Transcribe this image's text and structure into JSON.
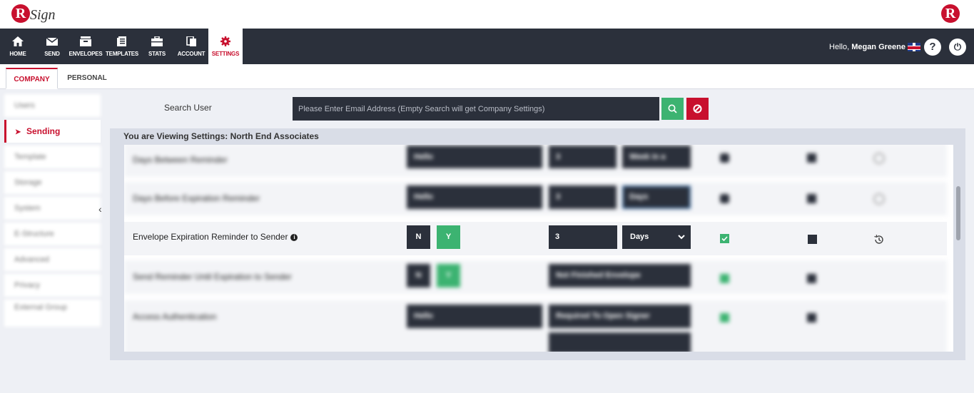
{
  "brand": {
    "logo_letter": "R",
    "logo_word": "Sign",
    "right_logo_letter": "R"
  },
  "nav": {
    "items": [
      {
        "label": "HOME"
      },
      {
        "label": "SEND"
      },
      {
        "label": "ENVELOPES"
      },
      {
        "label": "TEMPLATES"
      },
      {
        "label": "STATS"
      },
      {
        "label": "ACCOUNT"
      },
      {
        "label": "SETTINGS"
      }
    ],
    "greeting": "Hello,",
    "user_name": "Megan Greene",
    "help_glyph": "?",
    "power_glyph": "⏻"
  },
  "subtabs": [
    {
      "label": "COMPANY"
    },
    {
      "label": "PERSONAL"
    }
  ],
  "sidebar": {
    "items": [
      {
        "label": "Users"
      },
      {
        "label": "Sending"
      },
      {
        "label": "Template"
      },
      {
        "label": "Storage"
      },
      {
        "label": "System"
      },
      {
        "label": "E-Structure"
      },
      {
        "label": "Advanced"
      },
      {
        "label": "Privacy"
      },
      {
        "label": "External Group"
      }
    ],
    "collapse_glyph": "‹"
  },
  "search": {
    "label": "Search User",
    "placeholder": "Please Enter Email Address (Empty Search will get Company Settings)"
  },
  "panel": {
    "title": "You are Viewing Settings: North End Associates",
    "rows": [
      {
        "label": "Days Between Reminder",
        "value": "Hello",
        "num": "3",
        "unit": "Week in a"
      },
      {
        "label": "Days Before Expiration Reminder",
        "value": "Hello",
        "num": "3",
        "unit": "Days"
      },
      {
        "label": "Envelope Expiration Reminder to Sender",
        "toggle_n": "N",
        "toggle_y": "Y",
        "num": "3",
        "unit": "Days"
      },
      {
        "label": "Send Reminder Until Expiration to Sender",
        "toggle_n": "N",
        "toggle_y": "Y",
        "option": "Not Finished Envelope"
      },
      {
        "label": "Access Authentication",
        "value": "Hello",
        "option": "Required To Open Signer"
      }
    ]
  },
  "colors": {
    "accent": "#c8102e",
    "dark": "#2b303b",
    "green": "#3cb371"
  },
  "icons": [
    "home-icon",
    "send-icon",
    "envelopes-icon",
    "templates-icon",
    "stats-icon",
    "account-icon",
    "settings-icon",
    "search-icon",
    "clear-icon",
    "info-icon",
    "history-icon",
    "chevron-down-icon",
    "checkmark-icon"
  ]
}
